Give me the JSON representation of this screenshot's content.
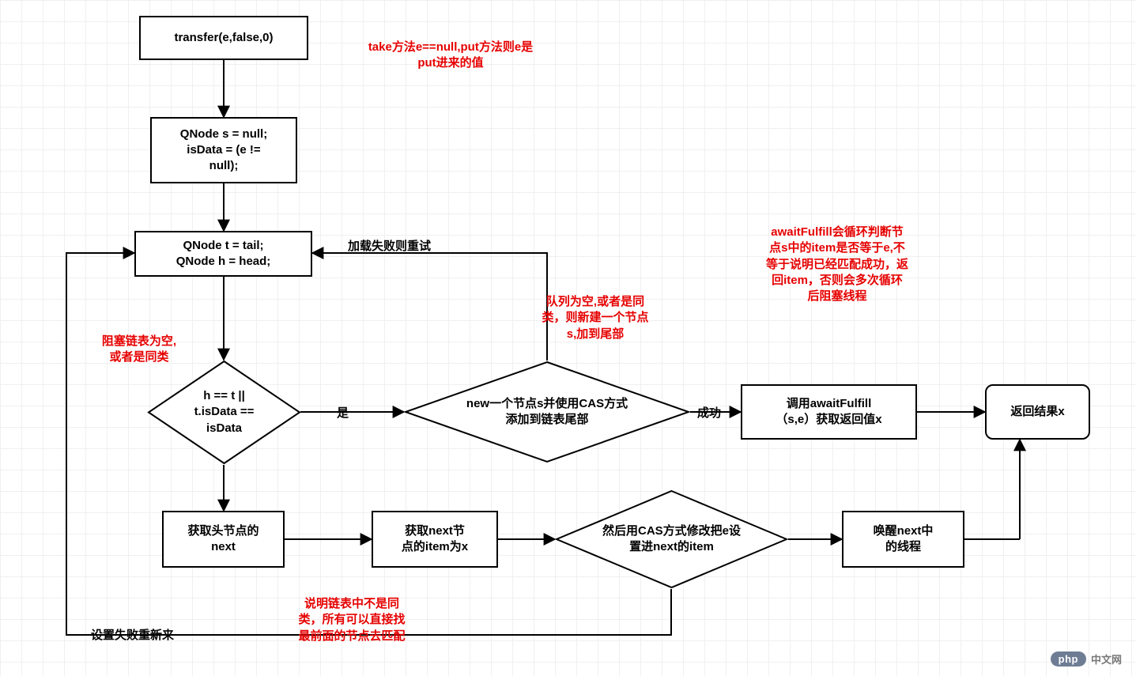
{
  "chart_data": {
    "type": "flowchart",
    "nodes": [
      {
        "id": "n1",
        "shape": "rect",
        "text": "transfer(e,false,0)"
      },
      {
        "id": "n2",
        "shape": "rect",
        "text": "QNode s = null;\nisData = (e !=\nnull);"
      },
      {
        "id": "n3",
        "shape": "rect",
        "text": "QNode t = tail;\nQNode h = head;"
      },
      {
        "id": "d1",
        "shape": "diamond",
        "text": "h == t ||\nt.isData ==\nisData"
      },
      {
        "id": "d2",
        "shape": "diamond",
        "text": "new一个节点s并使用CAS方式\n添加到链表尾部"
      },
      {
        "id": "n4",
        "shape": "rect",
        "text": "调用awaitFulfill\n（s,e）获取返回值x"
      },
      {
        "id": "n5",
        "shape": "round",
        "text": "返回结果x"
      },
      {
        "id": "n6",
        "shape": "rect",
        "text": "获取头节点的\nnext"
      },
      {
        "id": "n7",
        "shape": "rect",
        "text": "获取next节\n点的item为x"
      },
      {
        "id": "d3",
        "shape": "diamond",
        "text": "然后用CAS方式修改把e设\n置进next的item"
      },
      {
        "id": "n8",
        "shape": "rect",
        "text": "唤醒next中\n的线程"
      }
    ],
    "edges": [
      {
        "from": "n1",
        "to": "n2"
      },
      {
        "from": "n2",
        "to": "n3"
      },
      {
        "from": "n3",
        "to": "d1"
      },
      {
        "from": "d1",
        "to": "d2",
        "label": "是"
      },
      {
        "from": "d2",
        "to": "n4",
        "label": "成功"
      },
      {
        "from": "n4",
        "to": "n5"
      },
      {
        "from": "d2",
        "to": "n3",
        "label": "加载失败则重试"
      },
      {
        "from": "d1",
        "to": "n6"
      },
      {
        "from": "n6",
        "to": "n7"
      },
      {
        "from": "n7",
        "to": "d3"
      },
      {
        "from": "d3",
        "to": "n8"
      },
      {
        "from": "n8",
        "to": "n5"
      },
      {
        "from": "d3",
        "to": "n3",
        "label": "设置失败重新来"
      }
    ],
    "annotations": [
      {
        "text": "take方法e==null,put方法则e是\nput进来的值",
        "near": "n1"
      },
      {
        "text": "阻塞链表为空,\n或者是同类",
        "near": "d1"
      },
      {
        "text": "队列为空,或者是同\n类，则新建一个节点\ns,加到尾部",
        "near": "d2"
      },
      {
        "text": "awaitFulfill会循环判断节\n点s中的item是否等于e,不\n等于说明已经匹配成功，返\n回item，否则会多次循环\n后阻塞线程",
        "near": "n4"
      },
      {
        "text": "说明链表中不是同\n类，所有可以直接找\n最前面的节点去匹配",
        "near": "n7"
      }
    ]
  },
  "nodes": {
    "n1": "transfer(e,false,0)",
    "n2": "QNode s = null;\nisData = (e !=\nnull);",
    "n3": "QNode t = tail;\nQNode h = head;",
    "d1": "h == t ||\nt.isData ==\nisData",
    "d2": "new一个节点s并使用CAS方式\n添加到链表尾部",
    "n4": "调用awaitFulfill\n（s,e）获取返回值x",
    "n5": "返回结果x",
    "n6": "获取头节点的\nnext",
    "n7": "获取next节\n点的item为x",
    "d3": "然后用CAS方式修改把e设\n置进next的item",
    "n8": "唤醒next中\n的线程"
  },
  "edge_labels": {
    "d1_d2": "是",
    "d2_n4": "成功",
    "d2_n3": "加载失败则重试",
    "d3_n3": "设置失败重新来"
  },
  "annotations": {
    "a1": "take方法e==null,put方法则e是\nput进来的值",
    "a2": "阻塞链表为空,\n或者是同类",
    "a3": "队列为空,或者是同\n类，则新建一个节点\ns,加到尾部",
    "a4": "awaitFulfill会循环判断节\n点s中的item是否等于e,不\n等于说明已经匹配成功，返\n回item，否则会多次循环\n后阻塞线程",
    "a5": "说明链表中不是同\n类，所有可以直接找\n最前面的节点去匹配"
  },
  "logo": {
    "pill": "php",
    "text": "中文网"
  }
}
